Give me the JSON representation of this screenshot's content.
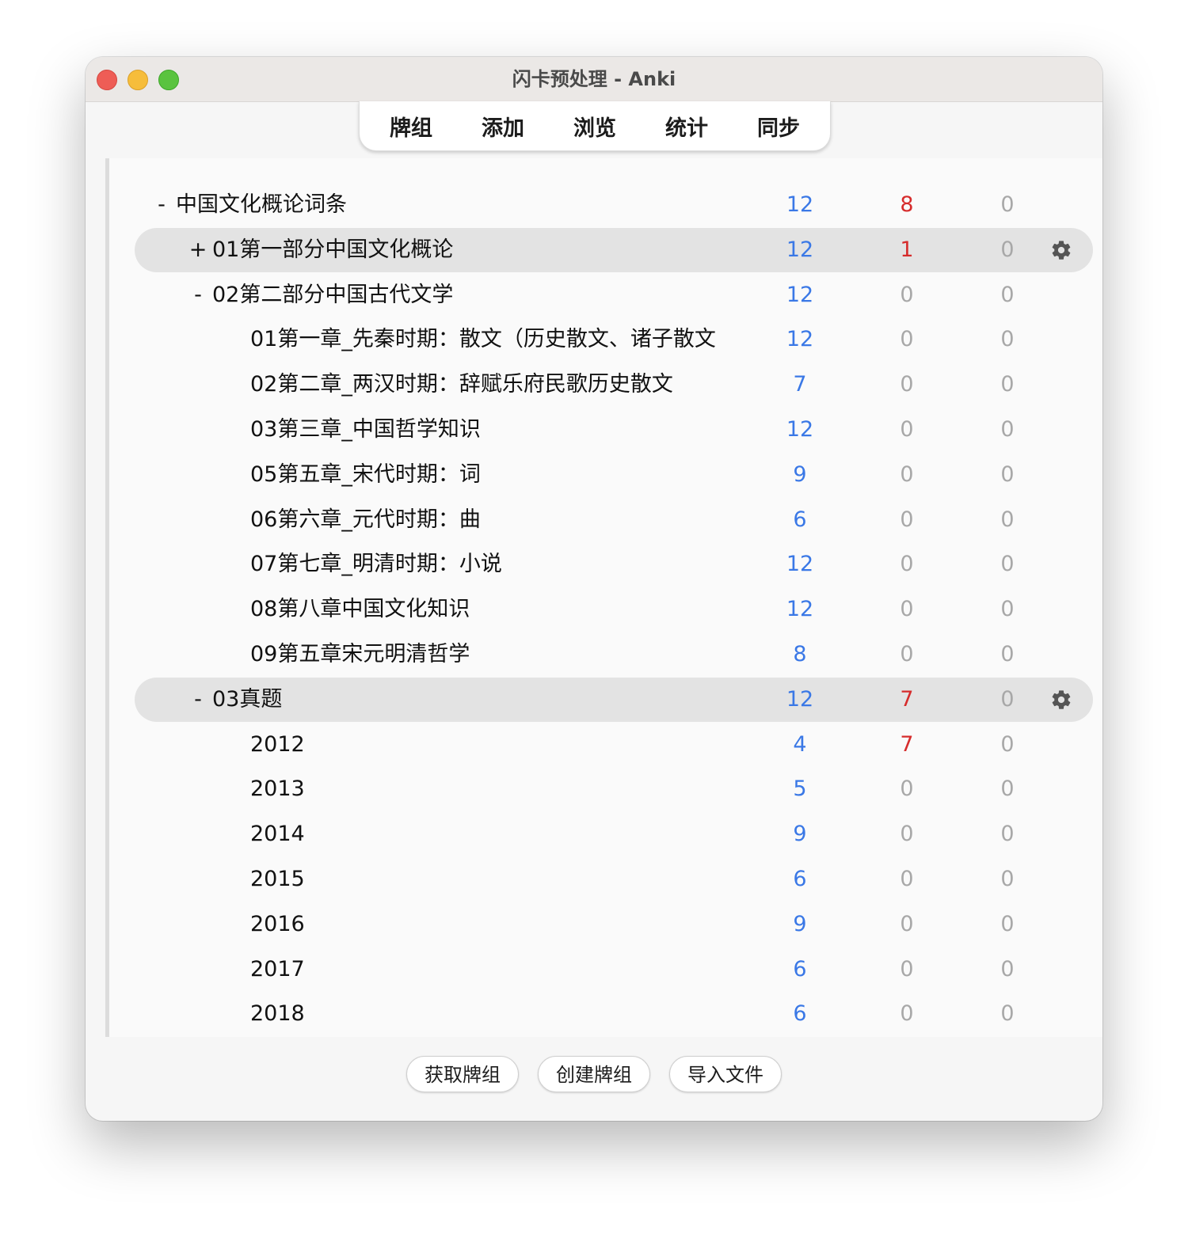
{
  "window": {
    "title": "闪卡预处理 - Anki"
  },
  "toolbar": {
    "tabs": [
      "牌组",
      "添加",
      "浏览",
      "统计",
      "同步"
    ]
  },
  "colors": {
    "new": "#3a78e6",
    "learn": "#d62c2c",
    "due": "#a8a8a8",
    "zero": "#a8a8a8"
  },
  "decks": [
    {
      "toggle": "-",
      "name": "中国文化概论词条",
      "new": "12",
      "learn": "8",
      "due": "0",
      "depth": 0,
      "current": false
    },
    {
      "toggle": "+",
      "name": "01第一部分中国文化概论",
      "new": "12",
      "learn": "1",
      "due": "0",
      "depth": 1,
      "current": true
    },
    {
      "toggle": "-",
      "name": "02第二部分中国古代文学",
      "new": "12",
      "learn": "0",
      "due": "0",
      "depth": 1,
      "current": false
    },
    {
      "toggle": "",
      "name": "01第一章_先秦时期：散文（历史散文、诸子散文",
      "new": "12",
      "learn": "0",
      "due": "0",
      "depth": 2,
      "current": false
    },
    {
      "toggle": "",
      "name": "02第二章_两汉时期：辞赋乐府民歌历史散文",
      "new": "7",
      "learn": "0",
      "due": "0",
      "depth": 2,
      "current": false
    },
    {
      "toggle": "",
      "name": "03第三章_中国哲学知识",
      "new": "12",
      "learn": "0",
      "due": "0",
      "depth": 2,
      "current": false
    },
    {
      "toggle": "",
      "name": "05第五章_宋代时期：词",
      "new": "9",
      "learn": "0",
      "due": "0",
      "depth": 2,
      "current": false
    },
    {
      "toggle": "",
      "name": "06第六章_元代时期：曲",
      "new": "6",
      "learn": "0",
      "due": "0",
      "depth": 2,
      "current": false
    },
    {
      "toggle": "",
      "name": "07第七章_明清时期：小说",
      "new": "12",
      "learn": "0",
      "due": "0",
      "depth": 2,
      "current": false
    },
    {
      "toggle": "",
      "name": "08第八章中国文化知识",
      "new": "12",
      "learn": "0",
      "due": "0",
      "depth": 2,
      "current": false
    },
    {
      "toggle": "",
      "name": "09第五章宋元明清哲学",
      "new": "8",
      "learn": "0",
      "due": "0",
      "depth": 2,
      "current": false
    },
    {
      "toggle": "-",
      "name": "03真题",
      "new": "12",
      "learn": "7",
      "due": "0",
      "depth": 1,
      "current": true
    },
    {
      "toggle": "",
      "name": "2012",
      "new": "4",
      "learn": "7",
      "due": "0",
      "depth": 2,
      "current": false
    },
    {
      "toggle": "",
      "name": "2013",
      "new": "5",
      "learn": "0",
      "due": "0",
      "depth": 2,
      "current": false
    },
    {
      "toggle": "",
      "name": "2014",
      "new": "9",
      "learn": "0",
      "due": "0",
      "depth": 2,
      "current": false
    },
    {
      "toggle": "",
      "name": "2015",
      "new": "6",
      "learn": "0",
      "due": "0",
      "depth": 2,
      "current": false
    },
    {
      "toggle": "",
      "name": "2016",
      "new": "9",
      "learn": "0",
      "due": "0",
      "depth": 2,
      "current": false
    },
    {
      "toggle": "",
      "name": "2017",
      "new": "6",
      "learn": "0",
      "due": "0",
      "depth": 2,
      "current": false
    },
    {
      "toggle": "",
      "name": "2018",
      "new": "6",
      "learn": "0",
      "due": "0",
      "depth": 2,
      "current": false
    }
  ],
  "bottom_buttons": [
    "获取牌组",
    "创建牌组",
    "导入文件"
  ]
}
